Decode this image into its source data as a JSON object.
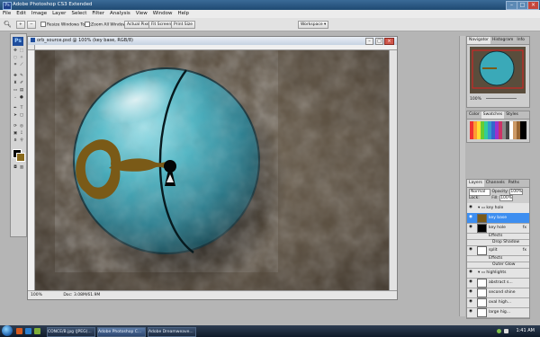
{
  "window": {
    "app_title": "Adobe Photoshop CS3 Extended",
    "ps_icon": "Ps"
  },
  "menu": [
    "File",
    "Edit",
    "Image",
    "Layer",
    "Select",
    "Filter",
    "Analysis",
    "View",
    "Window",
    "Help"
  ],
  "options": {
    "resize_label": "Resize Windows To Fit",
    "zoom_all_label": "Zoom All Windows",
    "actual_pixels": "Actual Pixels",
    "fit_screen": "Fit Screen",
    "print_size": "Print Size",
    "workspace": "Workspace ▾"
  },
  "toolbox": {
    "logo": "Ps"
  },
  "document": {
    "title": "orb_source.psd @ 100% (key base, RGB/8)",
    "zoom": "100%",
    "doc_size": "Doc: 3.08M/61.9M"
  },
  "navigator": {
    "tabs": [
      "Navigator",
      "Histogram",
      "Info"
    ],
    "zoom": "100%"
  },
  "color_panel": {
    "tabs": [
      "Color",
      "Swatches",
      "Styles"
    ]
  },
  "layers_panel": {
    "tabs": [
      "Layers",
      "Channels",
      "Paths"
    ],
    "mode": "Normal",
    "opacity_label": "Opacity:",
    "opacity": "100%",
    "fill_label": "Fill:",
    "fill": "100%",
    "lock_label": "Lock:",
    "layers": [
      {
        "name": "key hole",
        "kind": "group"
      },
      {
        "name": "key base",
        "kind": "layer",
        "selected": true
      },
      {
        "name": "key hole",
        "kind": "layer",
        "fx": "fx"
      },
      {
        "name": "Effects",
        "kind": "effect"
      },
      {
        "name": "Drop Shadow",
        "kind": "effect"
      },
      {
        "name": "split",
        "kind": "layer",
        "fx": "fx"
      },
      {
        "name": "Effects",
        "kind": "effect"
      },
      {
        "name": "Outer Glow",
        "kind": "effect"
      },
      {
        "name": "highlights",
        "kind": "group"
      },
      {
        "name": "abstract s...",
        "kind": "layer"
      },
      {
        "name": "second shine",
        "kind": "layer"
      },
      {
        "name": "oval high...",
        "kind": "layer"
      },
      {
        "name": "large hig...",
        "kind": "layer"
      }
    ]
  },
  "taskbar": {
    "items": [
      "CONCE/B.jpg (JPEG)...",
      "Adobe Photoshop C...",
      "Adobe Dreamweave..."
    ],
    "clock": "1:41 AM"
  },
  "colors": {
    "orb": "#3aa9b8",
    "key": "#7a5a17",
    "bg_stone": "#5a4d3c"
  }
}
